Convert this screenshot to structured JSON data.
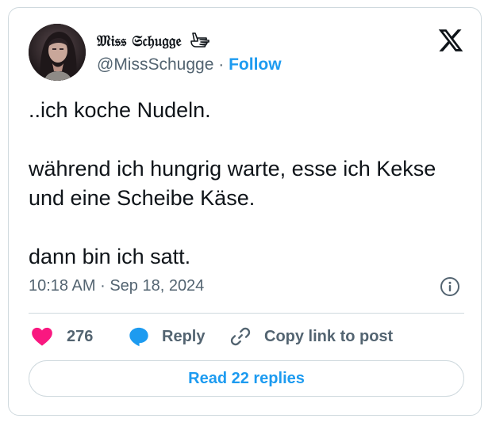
{
  "author": {
    "display_name": "𝔐𝔦𝔰𝔰 𝔖𝔠𝔥𝔲𝔤𝔤𝔢",
    "handle": "@MissSchugge",
    "separator": "·",
    "follow_label": "Follow"
  },
  "tweet": {
    "paragraphs": [
      "..ich koche Nudeln.",
      "während ich hungrig warte, esse ich Kekse und eine Scheibe Käse.",
      "dann bin ich satt."
    ]
  },
  "meta": {
    "time": "10:18 AM",
    "separator": "·",
    "date": "Sep 18, 2024"
  },
  "actions": {
    "like_count": "276",
    "reply_label": "Reply",
    "copy_label": "Copy link to post"
  },
  "read_replies_label": "Read 22 replies",
  "icons": {
    "logo": "x-logo-icon",
    "like": "heart-icon",
    "reply": "speech-bubble-icon",
    "copy": "link-icon",
    "info": "info-icon",
    "name_emblem": "pointing-hand-icon"
  },
  "colors": {
    "accent": "#1d9bf0",
    "like": "#f91880",
    "text": "#0f1419",
    "muted": "#536471",
    "border": "#cfd9de"
  }
}
